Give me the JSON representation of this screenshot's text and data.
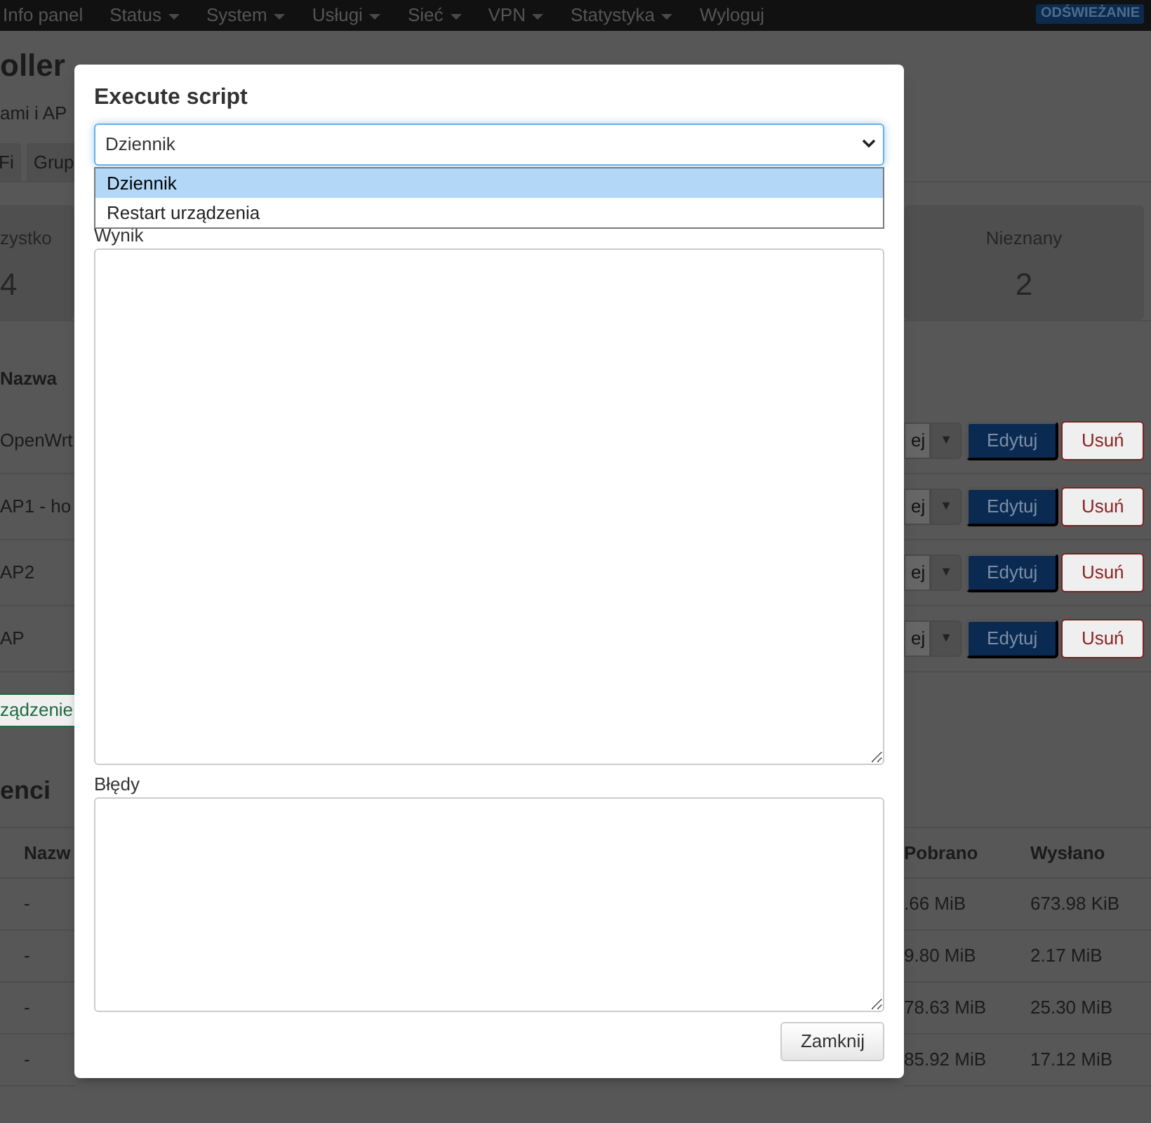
{
  "navbar": {
    "items": [
      {
        "label": "Info panel",
        "dropdown": false
      },
      {
        "label": "Status",
        "dropdown": true
      },
      {
        "label": "System",
        "dropdown": true
      },
      {
        "label": "Usługi",
        "dropdown": true
      },
      {
        "label": "Sieć",
        "dropdown": true
      },
      {
        "label": "VPN",
        "dropdown": true
      },
      {
        "label": "Statystyka",
        "dropdown": true
      },
      {
        "label": "Wyloguj",
        "dropdown": false
      }
    ],
    "badge": "ODŚWIEŻANIE"
  },
  "page": {
    "title": "oller",
    "subtitle": "ami i AP",
    "tabs": [
      {
        "label": "Fi"
      },
      {
        "label": "Grup"
      }
    ],
    "stats": [
      {
        "label": "zystko",
        "value": "4"
      },
      {
        "label": "Nieznany",
        "value": "2"
      }
    ],
    "devices": {
      "column": "Nazwa",
      "rows": [
        {
          "name": "OpenWrt",
          "more": "ej",
          "toggle": "▼",
          "edit": "Edytuj",
          "delete": "Usuń"
        },
        {
          "name": "AP1 - ho",
          "more": "ej",
          "toggle": "▼",
          "edit": "Edytuj",
          "delete": "Usuń"
        },
        {
          "name": "AP2",
          "more": "ej",
          "toggle": "▼",
          "edit": "Edytuj",
          "delete": "Usuń"
        },
        {
          "name": "AP",
          "more": "ej",
          "toggle": "▼",
          "edit": "Edytuj",
          "delete": "Usuń"
        }
      ]
    },
    "add_button": "ządzenie",
    "clients": {
      "heading": "enci",
      "columns": [
        "Nazw",
        "Pobrano",
        "Wysłano"
      ],
      "rows": [
        [
          "-",
          ".66 MiB",
          "673.98 KiB"
        ],
        [
          "-",
          "9.80 MiB",
          "2.17 MiB"
        ],
        [
          "-",
          "78.63 MiB",
          "25.30 MiB"
        ],
        [
          "-",
          "85.92 MiB",
          "17.12 MiB"
        ]
      ]
    }
  },
  "modal": {
    "title": "Execute script",
    "select_value": "Dziennik",
    "options": [
      {
        "label": "Dziennik",
        "selected": true
      },
      {
        "label": "Restart urządzenia",
        "selected": false
      }
    ],
    "output_label": "Wynik",
    "errors_label": "Błędy",
    "close_button": "Zamknij"
  }
}
